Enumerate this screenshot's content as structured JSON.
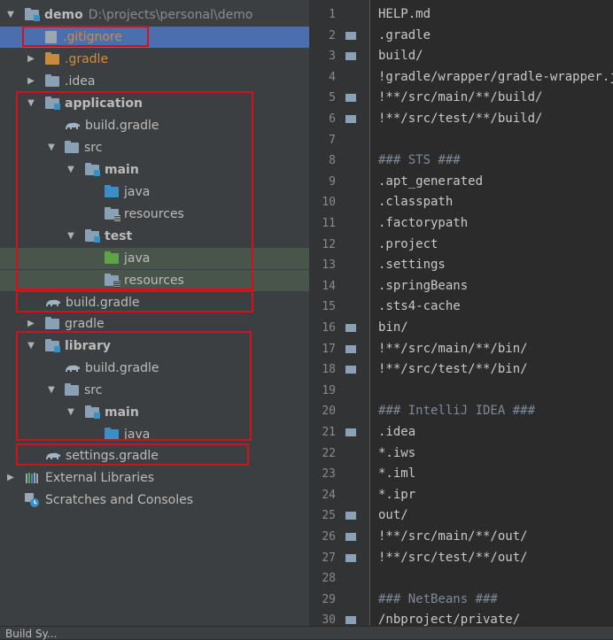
{
  "project": {
    "root_name": "demo",
    "root_path": "D:\\projects\\personal\\demo",
    "items": {
      "gitignore": ".gitignore",
      "gradle_dir": ".gradle",
      "idea": ".idea",
      "application": "application",
      "app_build": "build.gradle",
      "app_src": "src",
      "app_main": "main",
      "app_main_java": "java",
      "app_main_resources": "resources",
      "app_test": "test",
      "app_test_java": "java",
      "app_test_resources": "resources",
      "root_build": "build.gradle",
      "gradle": "gradle",
      "library": "library",
      "lib_build": "build.gradle",
      "lib_src": "src",
      "lib_main": "main",
      "lib_main_java": "java",
      "settings": "settings.gradle",
      "external": "External Libraries",
      "scratches": "Scratches and Consoles"
    }
  },
  "editor": {
    "lines": [
      {
        "n": "1",
        "text": "HELP.md"
      },
      {
        "n": "2",
        "text": ".gradle"
      },
      {
        "n": "3",
        "text": "build/"
      },
      {
        "n": "4",
        "text": "!gradle/wrapper/gradle-wrapper.jar"
      },
      {
        "n": "5",
        "text": "!**/src/main/**/build/"
      },
      {
        "n": "6",
        "text": "!**/src/test/**/build/"
      },
      {
        "n": "7",
        "text": ""
      },
      {
        "n": "8",
        "text": "### STS ###"
      },
      {
        "n": "9",
        "text": ".apt_generated"
      },
      {
        "n": "10",
        "text": ".classpath"
      },
      {
        "n": "11",
        "text": ".factorypath"
      },
      {
        "n": "12",
        "text": ".project"
      },
      {
        "n": "13",
        "text": ".settings"
      },
      {
        "n": "14",
        "text": ".springBeans"
      },
      {
        "n": "15",
        "text": ".sts4-cache"
      },
      {
        "n": "16",
        "text": "bin/"
      },
      {
        "n": "17",
        "text": "!**/src/main/**/bin/"
      },
      {
        "n": "18",
        "text": "!**/src/test/**/bin/"
      },
      {
        "n": "19",
        "text": ""
      },
      {
        "n": "20",
        "text": "### IntelliJ IDEA ###"
      },
      {
        "n": "21",
        "text": ".idea"
      },
      {
        "n": "22",
        "text": "*.iws"
      },
      {
        "n": "23",
        "text": "*.iml"
      },
      {
        "n": "24",
        "text": "*.ipr"
      },
      {
        "n": "25",
        "text": "out/"
      },
      {
        "n": "26",
        "text": "!**/src/main/**/out/"
      },
      {
        "n": "27",
        "text": "!**/src/test/**/out/"
      },
      {
        "n": "28",
        "text": ""
      },
      {
        "n": "29",
        "text": "### NetBeans ###"
      },
      {
        "n": "30",
        "text": "/nbproject/private/"
      }
    ]
  },
  "bottom_bar": {
    "label": "Build    Sy..."
  },
  "colors": {
    "highlight_box": "#d0131a",
    "selection": "#4b6eaf"
  }
}
